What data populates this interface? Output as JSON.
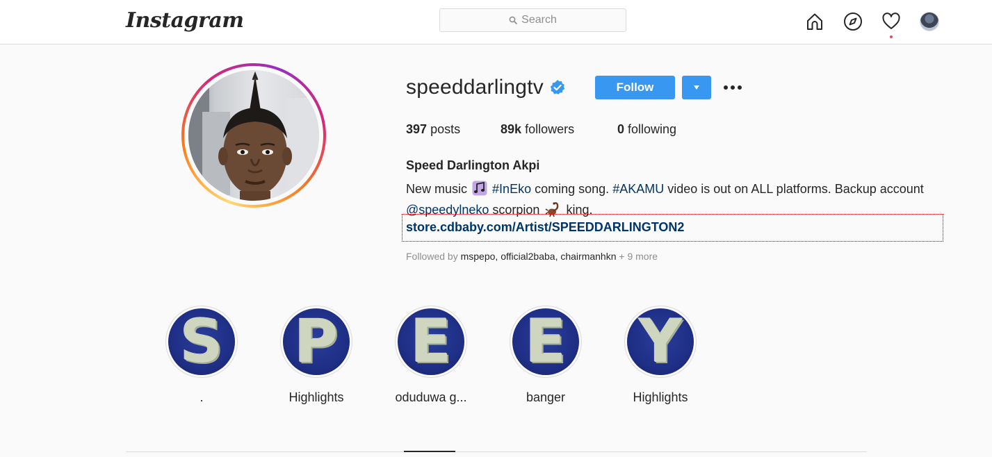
{
  "nav": {
    "logo": "Instagram",
    "search_placeholder": "Search",
    "icons": [
      "home-icon",
      "explore-icon",
      "activity-icon",
      "profile-avatar"
    ]
  },
  "profile": {
    "username": "speeddarlingtv",
    "verified": true,
    "follow_label": "Follow",
    "posts_count": "397",
    "posts_label": "posts",
    "followers_count": "89k",
    "followers_label": "followers",
    "following_count": "0",
    "following_label": "following",
    "full_name": "Speed Darlington Akpi",
    "bio": {
      "part1": "New music",
      "hashtag1": "#InEko",
      "part2": "coming song.",
      "hashtag2": "#AKAMU",
      "part3": "video is out on ALL platforms. Backup account",
      "mention": "@speedylneko",
      "part4": "scorpion",
      "part5": "king."
    },
    "external_link": "store.cdbaby.com/Artist/SPEEDDARLINGTON2",
    "followed_by": {
      "prefix": "Followed by",
      "names": [
        "mspepo",
        "official2baba",
        "chairmanhkn"
      ],
      "more": "+ 9 more"
    }
  },
  "highlights": [
    {
      "letter": "S",
      "label": "."
    },
    {
      "letter": "P",
      "label": "Highlights"
    },
    {
      "letter": "E",
      "label": "oduduwa g..."
    },
    {
      "letter": "E",
      "label": "banger"
    },
    {
      "letter": "Y",
      "label": "Highlights"
    }
  ],
  "colors": {
    "accent": "#3897f0",
    "link": "#003569",
    "text": "#262626",
    "muted": "#8e8e8e",
    "notification": "#ed4956"
  }
}
